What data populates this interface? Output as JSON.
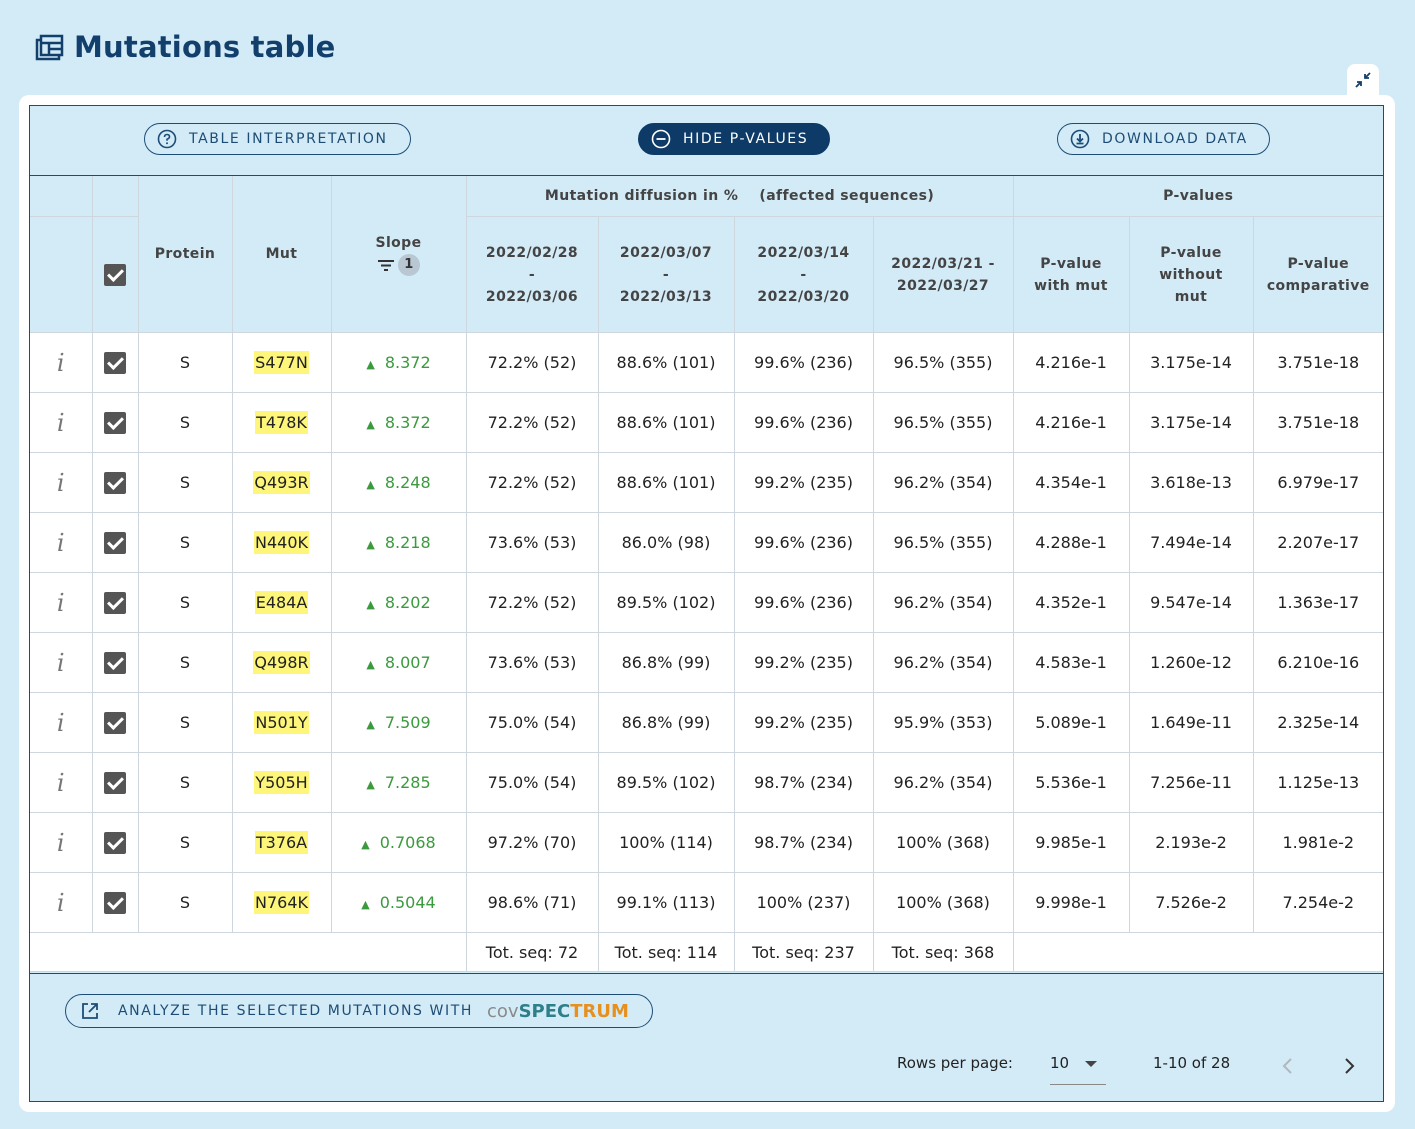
{
  "page": {
    "title": "Mutations table"
  },
  "toolbar": {
    "interpretation_label": "TABLE INTERPRETATION",
    "hide_pvalues_label": "HIDE P-VALUES",
    "download_label": "DOWNLOAD DATA"
  },
  "headers": {
    "protein": "Protein",
    "mut": "Mut",
    "slope": "Slope",
    "sort_badge": "1",
    "diffusion_prefix": "Mutation diffusion in %",
    "diffusion_suffix": "(affected sequences)",
    "pvalues_group": "P-values",
    "dates": [
      {
        "start": "2022/02/28",
        "sep": "-",
        "end": "2022/03/06"
      },
      {
        "start": "2022/03/07",
        "sep": "-",
        "end": "2022/03/13"
      },
      {
        "start": "2022/03/14",
        "sep": "-",
        "end": "2022/03/20"
      },
      {
        "start": "2022/03/21 -",
        "sep": "",
        "end": "2022/03/27"
      }
    ],
    "pval_with": [
      "P-value",
      "with mut"
    ],
    "pval_without": [
      "P-value",
      "without",
      "mut"
    ],
    "pval_comp": [
      "P-value",
      "comparative"
    ]
  },
  "rows": [
    {
      "info": "i",
      "protein": "S",
      "mut": "S477N",
      "slope": "8.372",
      "w1": "72.2% (52)",
      "w2": "88.6% (101)",
      "w3": "99.6% (236)",
      "w4": "96.5% (355)",
      "p_with": "4.216e-1",
      "p_without": "3.175e-14",
      "p_comp": "3.751e-18"
    },
    {
      "info": "i",
      "protein": "S",
      "mut": "T478K",
      "slope": "8.372",
      "w1": "72.2% (52)",
      "w2": "88.6% (101)",
      "w3": "99.6% (236)",
      "w4": "96.5% (355)",
      "p_with": "4.216e-1",
      "p_without": "3.175e-14",
      "p_comp": "3.751e-18"
    },
    {
      "info": "i",
      "protein": "S",
      "mut": "Q493R",
      "slope": "8.248",
      "w1": "72.2% (52)",
      "w2": "88.6% (101)",
      "w3": "99.2% (235)",
      "w4": "96.2% (354)",
      "p_with": "4.354e-1",
      "p_without": "3.618e-13",
      "p_comp": "6.979e-17"
    },
    {
      "info": "i",
      "protein": "S",
      "mut": "N440K",
      "slope": "8.218",
      "w1": "73.6% (53)",
      "w2": "86.0% (98)",
      "w3": "99.6% (236)",
      "w4": "96.5% (355)",
      "p_with": "4.288e-1",
      "p_without": "7.494e-14",
      "p_comp": "2.207e-17"
    },
    {
      "info": "i",
      "protein": "S",
      "mut": "E484A",
      "slope": "8.202",
      "w1": "72.2% (52)",
      "w2": "89.5% (102)",
      "w3": "99.6% (236)",
      "w4": "96.2% (354)",
      "p_with": "4.352e-1",
      "p_without": "9.547e-14",
      "p_comp": "1.363e-17"
    },
    {
      "info": "i",
      "protein": "S",
      "mut": "Q498R",
      "slope": "8.007",
      "w1": "73.6% (53)",
      "w2": "86.8% (99)",
      "w3": "99.2% (235)",
      "w4": "96.2% (354)",
      "p_with": "4.583e-1",
      "p_without": "1.260e-12",
      "p_comp": "6.210e-16"
    },
    {
      "info": "i",
      "protein": "S",
      "mut": "N501Y",
      "slope": "7.509",
      "w1": "75.0% (54)",
      "w2": "86.8% (99)",
      "w3": "99.2% (235)",
      "w4": "95.9% (353)",
      "p_with": "5.089e-1",
      "p_without": "1.649e-11",
      "p_comp": "2.325e-14"
    },
    {
      "info": "i",
      "protein": "S",
      "mut": "Y505H",
      "slope": "7.285",
      "w1": "75.0% (54)",
      "w2": "89.5% (102)",
      "w3": "98.7% (234)",
      "w4": "96.2% (354)",
      "p_with": "5.536e-1",
      "p_without": "7.256e-11",
      "p_comp": "1.125e-13"
    },
    {
      "info": "i",
      "protein": "S",
      "mut": "T376A",
      "slope": "0.7068",
      "w1": "97.2% (70)",
      "w2": "100% (114)",
      "w3": "98.7% (234)",
      "w4": "100% (368)",
      "p_with": "9.985e-1",
      "p_without": "2.193e-2",
      "p_comp": "1.981e-2"
    },
    {
      "info": "i",
      "protein": "S",
      "mut": "N764K",
      "slope": "0.5044",
      "w1": "98.6% (71)",
      "w2": "99.1% (113)",
      "w3": "100% (237)",
      "w4": "100% (368)",
      "p_with": "9.998e-1",
      "p_without": "7.526e-2",
      "p_comp": "7.254e-2"
    }
  ],
  "totals": [
    "Tot. seq: 72",
    "Tot. seq: 114",
    "Tot. seq: 237",
    "Tot. seq: 368"
  ],
  "footer": {
    "analyze_label": "ANALYZE THE SELECTED MUTATIONS WITH",
    "cov_brand": {
      "cov": "cov",
      "spec": "SPEC",
      "trum": "TRUM"
    },
    "rows_per_page_label": "Rows per page:",
    "rows_per_page_value": "10",
    "range_text": "1-10 of 28"
  },
  "colors": {
    "accent_dark": "#0d3a66",
    "background": "#d3ebf7",
    "slope_green": "#3a9a3d",
    "mut_highlight": "#fdf67a"
  }
}
